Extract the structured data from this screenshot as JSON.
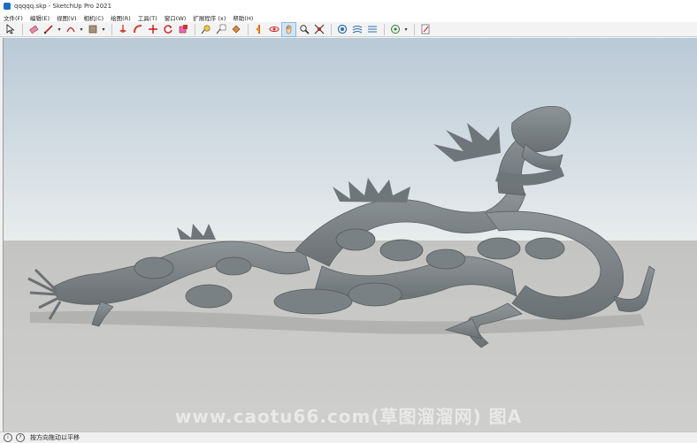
{
  "window": {
    "title": "qqqqq.skp - SketchUp Pro 2021"
  },
  "menu": [
    "文件(F)",
    "编辑(E)",
    "视图(V)",
    "相机(C)",
    "绘图(R)",
    "工具(T)",
    "窗口(W)",
    "扩展程序 (x)",
    "帮助(H)"
  ],
  "toolbar": {
    "tools": [
      "select-icon",
      "eraser-icon",
      "line-icon",
      "arc-icon",
      "rectangle-icon",
      "push-pull-icon",
      "follow-me-icon",
      "move-icon",
      "rotate-icon",
      "scale-icon",
      "tape-measure-icon",
      "text-icon",
      "paint-bucket-icon",
      "section-plane-icon",
      "orbit-icon",
      "pan-icon",
      "zoom-icon",
      "zoom-extents-icon",
      "warehouse-icon",
      "extension-warehouse-icon",
      "send-to-layout-icon",
      "geo-location-icon",
      "model-info-icon"
    ],
    "active_tool": "pan-icon"
  },
  "status": {
    "text": "按方向拖动以平移"
  },
  "viewport": {
    "sky_color": "#c9d6df",
    "ground_color": "#c8c8c6",
    "model_color": "#7d8487"
  },
  "watermark": {
    "text": "www.caotu66.com(草图溜溜网) 图A"
  }
}
